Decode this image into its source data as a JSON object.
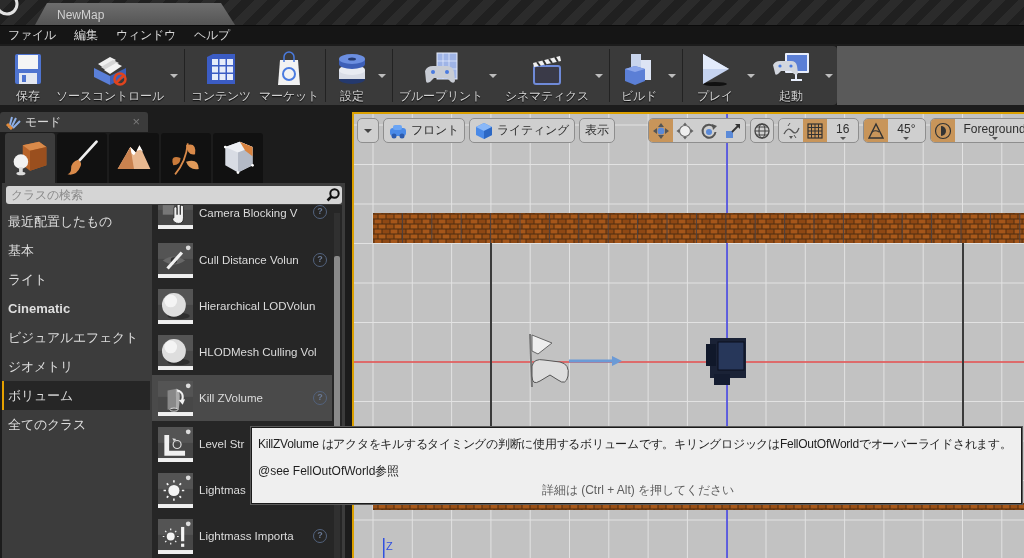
{
  "title_bar": {
    "document_tab": "NewMap"
  },
  "menu": [
    "ファイル",
    "編集",
    "ウィンドウ",
    "ヘルプ"
  ],
  "toolbar": {
    "groups": [
      {
        "buttons": [
          {
            "label": "保存",
            "dropdown": false
          },
          {
            "label": "ソースコントロール",
            "dropdown": true
          }
        ]
      },
      {
        "buttons": [
          {
            "label": "コンテンツ",
            "dropdown": false
          },
          {
            "label": "マーケット",
            "dropdown": false
          }
        ]
      },
      {
        "buttons": [
          {
            "label": "設定",
            "dropdown": true
          }
        ]
      },
      {
        "buttons": [
          {
            "label": "ブループリント",
            "dropdown": true
          },
          {
            "label": "シネマティクス",
            "dropdown": true
          }
        ]
      },
      {
        "buttons": [
          {
            "label": "ビルド",
            "dropdown": true
          }
        ]
      },
      {
        "buttons": [
          {
            "label": "プレイ",
            "dropdown": true
          },
          {
            "label": "起動",
            "dropdown": true
          }
        ]
      }
    ]
  },
  "modes_panel": {
    "title": "モード",
    "close": "×",
    "mode_tabs": [
      {
        "selected": true
      },
      {
        "selected": false
      },
      {
        "selected": false
      },
      {
        "selected": false
      },
      {
        "selected": false
      }
    ],
    "search": {
      "placeholder": "クラスの検索"
    },
    "categories": [
      {
        "label": "最近配置したもの",
        "selected": false,
        "emphasized": false
      },
      {
        "label": "基本",
        "selected": false,
        "emphasized": false
      },
      {
        "label": "ライト",
        "selected": false,
        "emphasized": false
      },
      {
        "label": "Cinematic",
        "selected": false,
        "emphasized": true
      },
      {
        "label": "ビジュアルエフェクト",
        "selected": false,
        "emphasized": false
      },
      {
        "label": "ジオメトリ",
        "selected": false,
        "emphasized": false
      },
      {
        "label": "ボリューム",
        "selected": true,
        "emphasized": false
      },
      {
        "label": "全てのクラス",
        "selected": false,
        "emphasized": false
      }
    ],
    "classes": [
      {
        "label": "Camera Blocking V",
        "help": "?",
        "selected": false
      },
      {
        "label": "Cull Distance Volun",
        "help": "?",
        "selected": false
      },
      {
        "label": "Hierarchical LODVolun",
        "selected": false
      },
      {
        "label": "HLODMesh Culling Vol",
        "selected": false
      },
      {
        "label": "Kill ZVolume",
        "help": "?",
        "selected": true
      },
      {
        "label": "Level Str",
        "selected": false
      },
      {
        "label": "Lightmas",
        "selected": false
      },
      {
        "label": "Lightmass Importa",
        "help": "?",
        "selected": false
      }
    ]
  },
  "viewport": {
    "toolbar": {
      "buttons": [
        {
          "label": "フロント"
        },
        {
          "label": "ライティング"
        },
        {
          "label": "表示"
        }
      ],
      "transform_tools": [
        {
          "selected": true
        },
        {
          "selected": false
        },
        {
          "selected": false
        },
        {
          "selected": false
        }
      ],
      "surface_snap": {
        "on": false
      },
      "grid_snap": {
        "on": true,
        "value": "16"
      },
      "rotation_snap": {
        "on": true,
        "value": "45°"
      },
      "layer": {
        "on": true,
        "value": "Foreground"
      }
    },
    "axis_label": "Z"
  },
  "tooltip": {
    "description": "KillZVolume はアクタをキルするタイミングの判断に使用するボリュームです。キリングロジックはFellOutOfWorldでオーバーライドされます。",
    "see_also": "@see FellOutOfWorld参照",
    "hint": "詳細は (Ctrl + Alt) を押してください"
  }
}
